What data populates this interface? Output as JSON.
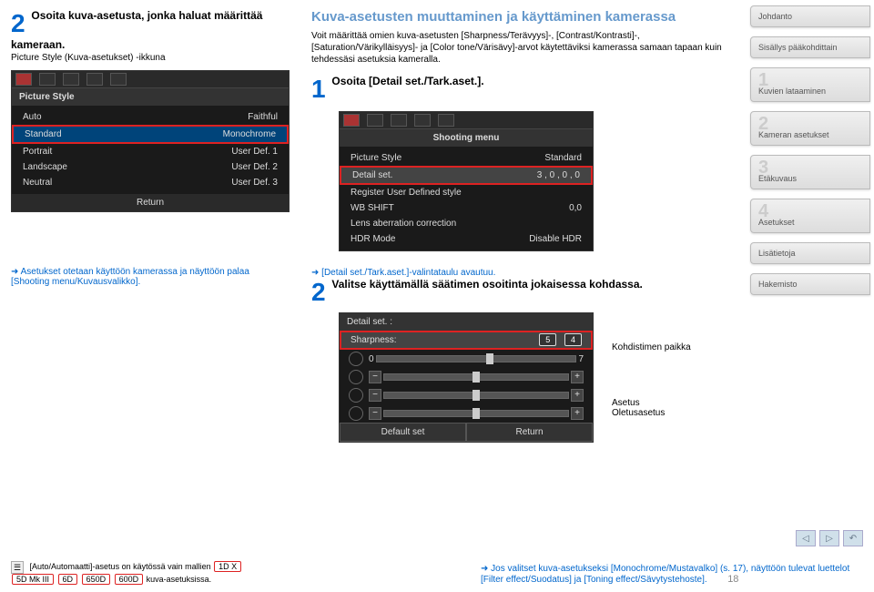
{
  "left": {
    "step_num": "2",
    "step_title": "Osoita kuva-asetusta, jonka haluat määrittää kameraan.",
    "step_sub": "Picture Style (Kuva-asetukset) -ikkuna",
    "ps_header": "Picture Style",
    "ps_rows": [
      {
        "l": "Auto",
        "r": "Faithful"
      },
      {
        "l": "Standard",
        "r": "Monochrome"
      },
      {
        "l": "Portrait",
        "r": "User Def. 1"
      },
      {
        "l": "Landscape",
        "r": "User Def. 2"
      },
      {
        "l": "Neutral",
        "r": "User Def. 3"
      }
    ],
    "ps_return": "Return",
    "note": "Asetukset otetaan käyttöön kamerassa ja näyttöön palaa [Shooting menu/Kuvausvalikko]."
  },
  "mid": {
    "title": "Kuva-asetusten muuttaminen ja käyttäminen kamerassa",
    "body": "Voit määrittää omien kuva-asetusten [Sharpness/Terävyys]-, [Contrast/Kontrasti]-, [Saturation/Värikylläisyys]- ja [Color tone/Värisävy]-arvot käytettäviksi kamerassa samaan tapaan kuin tehdessäsi asetuksia kameralla.",
    "step1_num": "1",
    "step1_title": "Osoita [Detail set./Tark.aset.].",
    "menu": {
      "header": "Shooting menu",
      "rows": [
        {
          "l": "Picture Style",
          "r": "Standard"
        },
        {
          "l": "Detail set.",
          "r": "3 , 0 , 0 , 0"
        },
        {
          "l": "Register User Defined style",
          "r": ""
        },
        {
          "l": "WB SHIFT",
          "r": "0,0"
        },
        {
          "l": "Lens aberration correction",
          "r": ""
        },
        {
          "l": "HDR Mode",
          "r": "Disable HDR"
        }
      ]
    },
    "note2": "[Detail set./Tark.aset.]-valintataulu avautuu.",
    "step2_num": "2",
    "step2_title": "Valitse käyttämällä säätimen osoitinta jokaisessa kohdassa.",
    "detail": {
      "title": "Detail set.   :",
      "sharp_l": "Sharpness:",
      "sharp_v1": "5",
      "sharp_v2": "4",
      "scale_end": "7",
      "btn_default": "Default set",
      "btn_return": "Return"
    },
    "callout_cursor": "Kohdistimen paikka",
    "callout_set": "Asetus",
    "callout_default": "Oletusasetus"
  },
  "right": {
    "tabs": [
      "Johdanto",
      "Sisällys pääkohdittain",
      "Kuvien lataaminen",
      "Kameran asetukset",
      "Etäkuvaus",
      "Asetukset",
      "Lisätietoja",
      "Hakemisto"
    ],
    "big_nums": [
      "",
      "",
      "1",
      "2",
      "3",
      "4",
      "",
      ""
    ]
  },
  "footer": {
    "note_left_pre": "[Auto/Automaatti]-asetus on käytössä vain mallien",
    "chips": [
      "1D X",
      "5D Mk III",
      "6D",
      "650D",
      "600D"
    ],
    "note_left_post": "kuva-asetuksissa.",
    "note_right": "Jos valitset kuva-asetukseksi [Monochrome/Mustavalko] (s. 17), näyttöön tulevat luettelot [Filter effect/Suodatus] ja [Toning effect/Sävytystehoste].",
    "page": "18"
  }
}
